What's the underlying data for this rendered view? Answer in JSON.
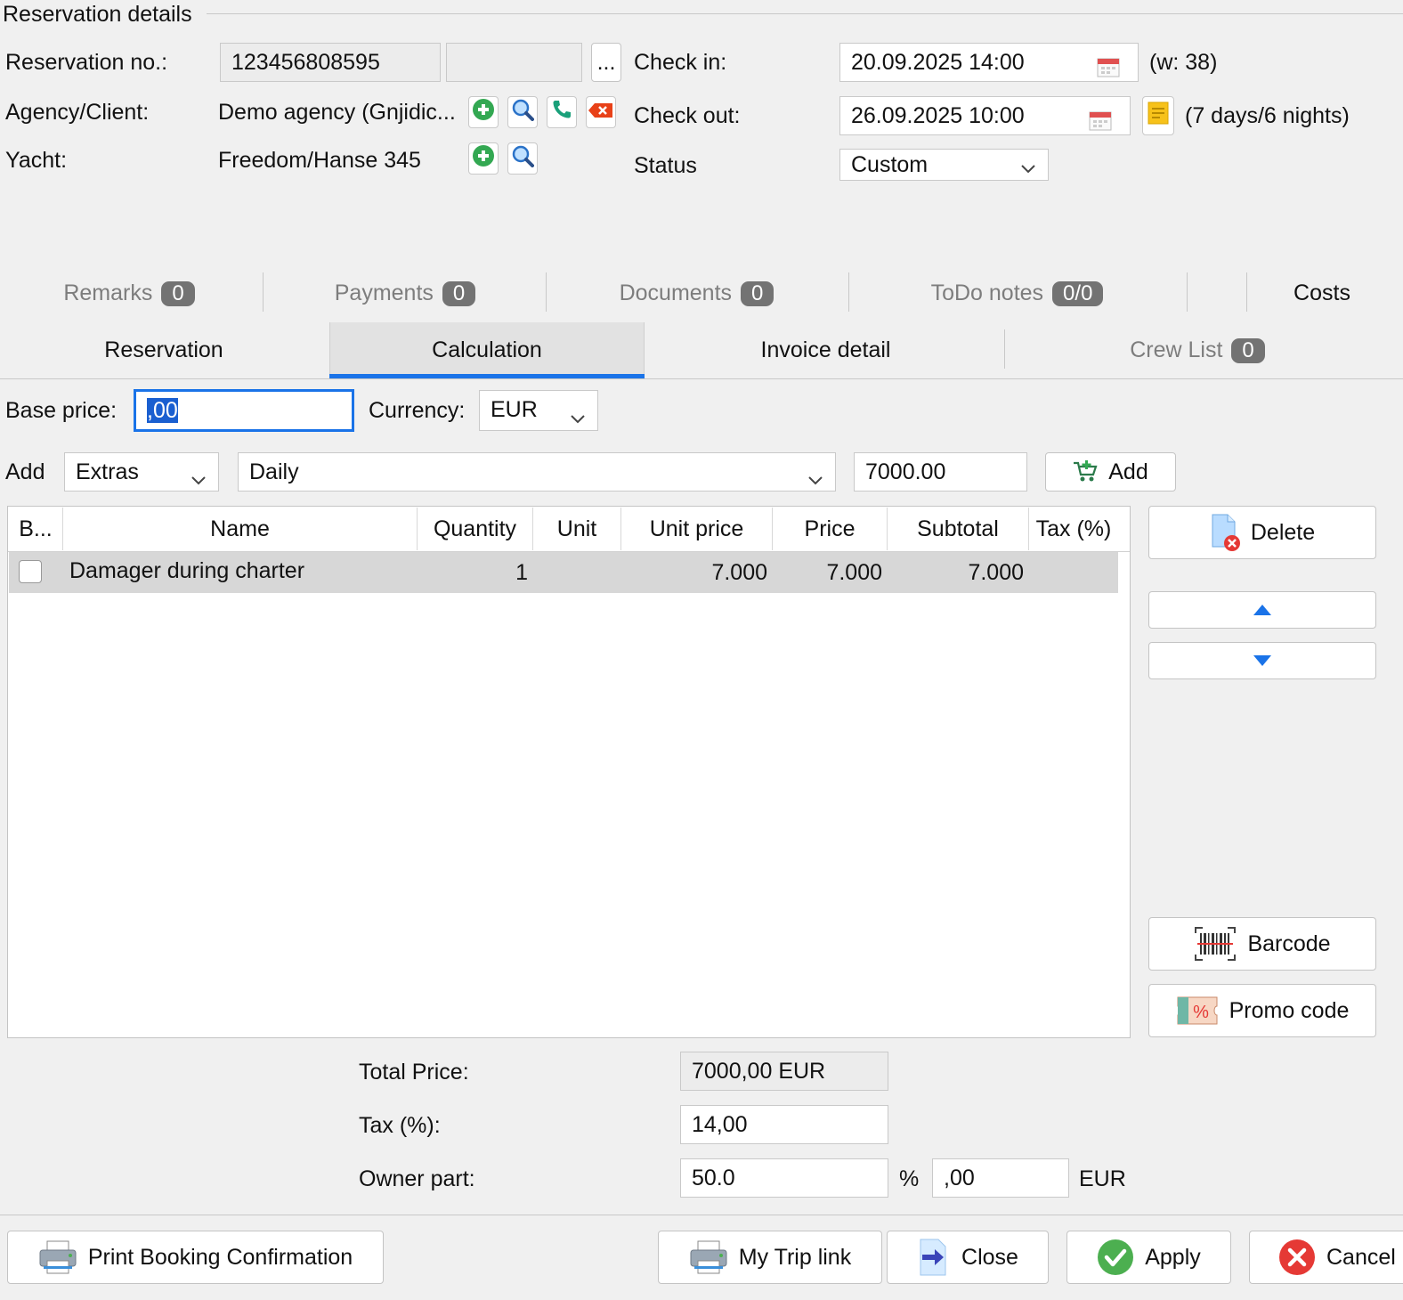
{
  "window": {
    "title": "Reservation details"
  },
  "reservation": {
    "no_label": "Reservation no.:",
    "no_value": "123456808595",
    "no_extra": "",
    "more_label": "...",
    "agency_label": "Agency/Client:",
    "agency_value": "Demo agency (Gnjidic...",
    "yacht_label": "Yacht:",
    "yacht_value": "Freedom/Hanse 345",
    "checkin_label": "Check in:",
    "checkin_value": "20.09.2025 14:00",
    "week": "(w: 38)",
    "checkout_label": "Check out:",
    "checkout_value": "26.09.2025 10:00",
    "duration": "(7 days/6 nights)",
    "status_label": "Status",
    "status_value": "Custom"
  },
  "tabs_row1": [
    {
      "label": "Remarks",
      "count": "0"
    },
    {
      "label": "Payments",
      "count": "0"
    },
    {
      "label": "Documents",
      "count": "0"
    },
    {
      "label": "ToDo notes",
      "count": "0/0"
    },
    {
      "label": "Costs"
    }
  ],
  "tabs_row2": [
    {
      "label": "Reservation"
    },
    {
      "label": "Calculation",
      "active": true
    },
    {
      "label": "Invoice detail"
    },
    {
      "label": "Crew List",
      "count": "0"
    }
  ],
  "calc": {
    "base_price_label": "Base price:",
    "base_price_value": ",00",
    "currency_label": "Currency:",
    "currency_value": "EUR",
    "add_label": "Add",
    "add_type": "Extras",
    "add_item": "Daily",
    "add_amount": "7000.00",
    "add_button": "Add"
  },
  "table": {
    "columns": [
      "B...",
      "Name",
      "Quantity",
      "Unit",
      "Unit price",
      "Price",
      "Subtotal",
      "Tax (%)"
    ],
    "rows": [
      {
        "name": "Damager during charter",
        "quantity": "1",
        "unit": "",
        "unit_price": "7.000",
        "price": "7.000",
        "subtotal": "7.000",
        "tax": ""
      }
    ]
  },
  "side_buttons": {
    "delete": "Delete",
    "barcode": "Barcode",
    "promo": "Promo code"
  },
  "totals": {
    "total_label": "Total Price:",
    "total_value": "7000,00 EUR",
    "tax_label": "Tax (%):",
    "tax_value": "14,00",
    "owner_label": "Owner part:",
    "owner_percent": "50.0",
    "percent_sign": "%",
    "owner_amount": ",00",
    "owner_currency": "EUR"
  },
  "footer": {
    "print": "Print Booking Confirmation",
    "trip": "My Trip link",
    "close": "Close",
    "apply": "Apply",
    "cancel": "Cancel"
  },
  "colors": {
    "accent": "#1a73e8",
    "add_green": "#33a852",
    "delete_red": "#e53935"
  }
}
